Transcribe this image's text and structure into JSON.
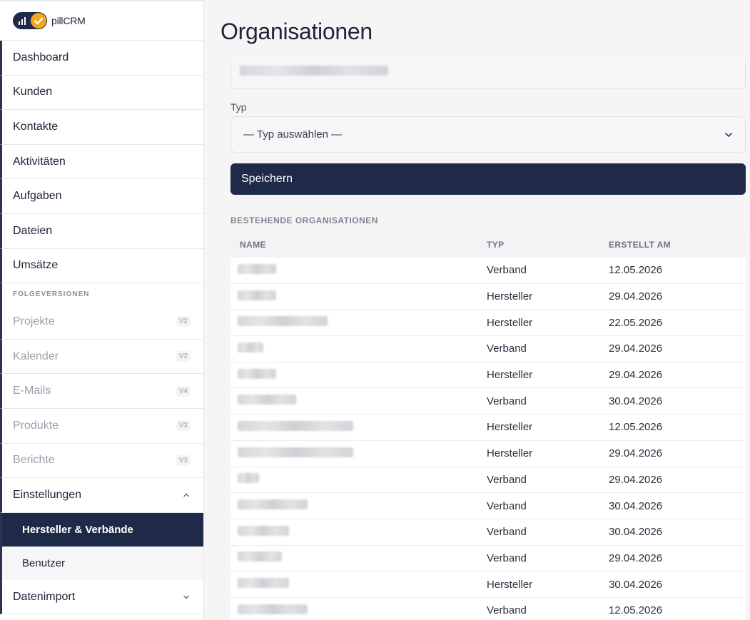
{
  "app": {
    "name": "pillCRM"
  },
  "sidebar": {
    "items": [
      {
        "label": "Dashboard"
      },
      {
        "label": "Kunden"
      },
      {
        "label": "Kontakte"
      },
      {
        "label": "Aktivitäten"
      },
      {
        "label": "Aufgaben"
      },
      {
        "label": "Dateien"
      },
      {
        "label": "Umsätze"
      }
    ],
    "section_label": "FOLGEVERSIONEN",
    "future_items": [
      {
        "label": "Projekte",
        "badge": "V2"
      },
      {
        "label": "Kalender",
        "badge": "V2"
      },
      {
        "label": "E-Mails",
        "badge": "V4"
      },
      {
        "label": "Produkte",
        "badge": "V3"
      },
      {
        "label": "Berichte",
        "badge": "V3"
      }
    ],
    "settings": {
      "label": "Einstellungen",
      "children": [
        {
          "label": "Hersteller & Verbände",
          "active": true
        },
        {
          "label": "Benutzer"
        }
      ]
    },
    "import": {
      "label": "Datenimport"
    }
  },
  "main": {
    "title": "Organisationen",
    "form": {
      "type_label": "Typ",
      "type_select_value": "— Typ auswählen —",
      "save_label": "Speichern"
    },
    "table": {
      "section_title": "BESTEHENDE ORGANISATIONEN",
      "headers": [
        "NAME",
        "TYP",
        "ERSTELLT AM"
      ],
      "rows": [
        {
          "typ": "Verband",
          "date": "12.05.2026"
        },
        {
          "typ": "Hersteller",
          "date": "29.04.2026"
        },
        {
          "typ": "Hersteller",
          "date": "22.05.2026"
        },
        {
          "typ": "Verband",
          "date": "29.04.2026"
        },
        {
          "typ": "Hersteller",
          "date": "29.04.2026"
        },
        {
          "typ": "Verband",
          "date": "30.04.2026"
        },
        {
          "typ": "Hersteller",
          "date": "12.05.2026"
        },
        {
          "typ": "Hersteller",
          "date": "29.04.2026"
        },
        {
          "typ": "Verband",
          "date": "29.04.2026"
        },
        {
          "typ": "Verband",
          "date": "30.04.2026"
        },
        {
          "typ": "Verband",
          "date": "30.04.2026"
        },
        {
          "typ": "Verband",
          "date": "29.04.2026"
        },
        {
          "typ": "Hersteller",
          "date": "30.04.2026"
        },
        {
          "typ": "Verband",
          "date": "12.05.2026"
        }
      ]
    }
  },
  "colors": {
    "primary": "#1e2a47",
    "accent": "#f2a71b",
    "background": "#f5f5f6"
  }
}
